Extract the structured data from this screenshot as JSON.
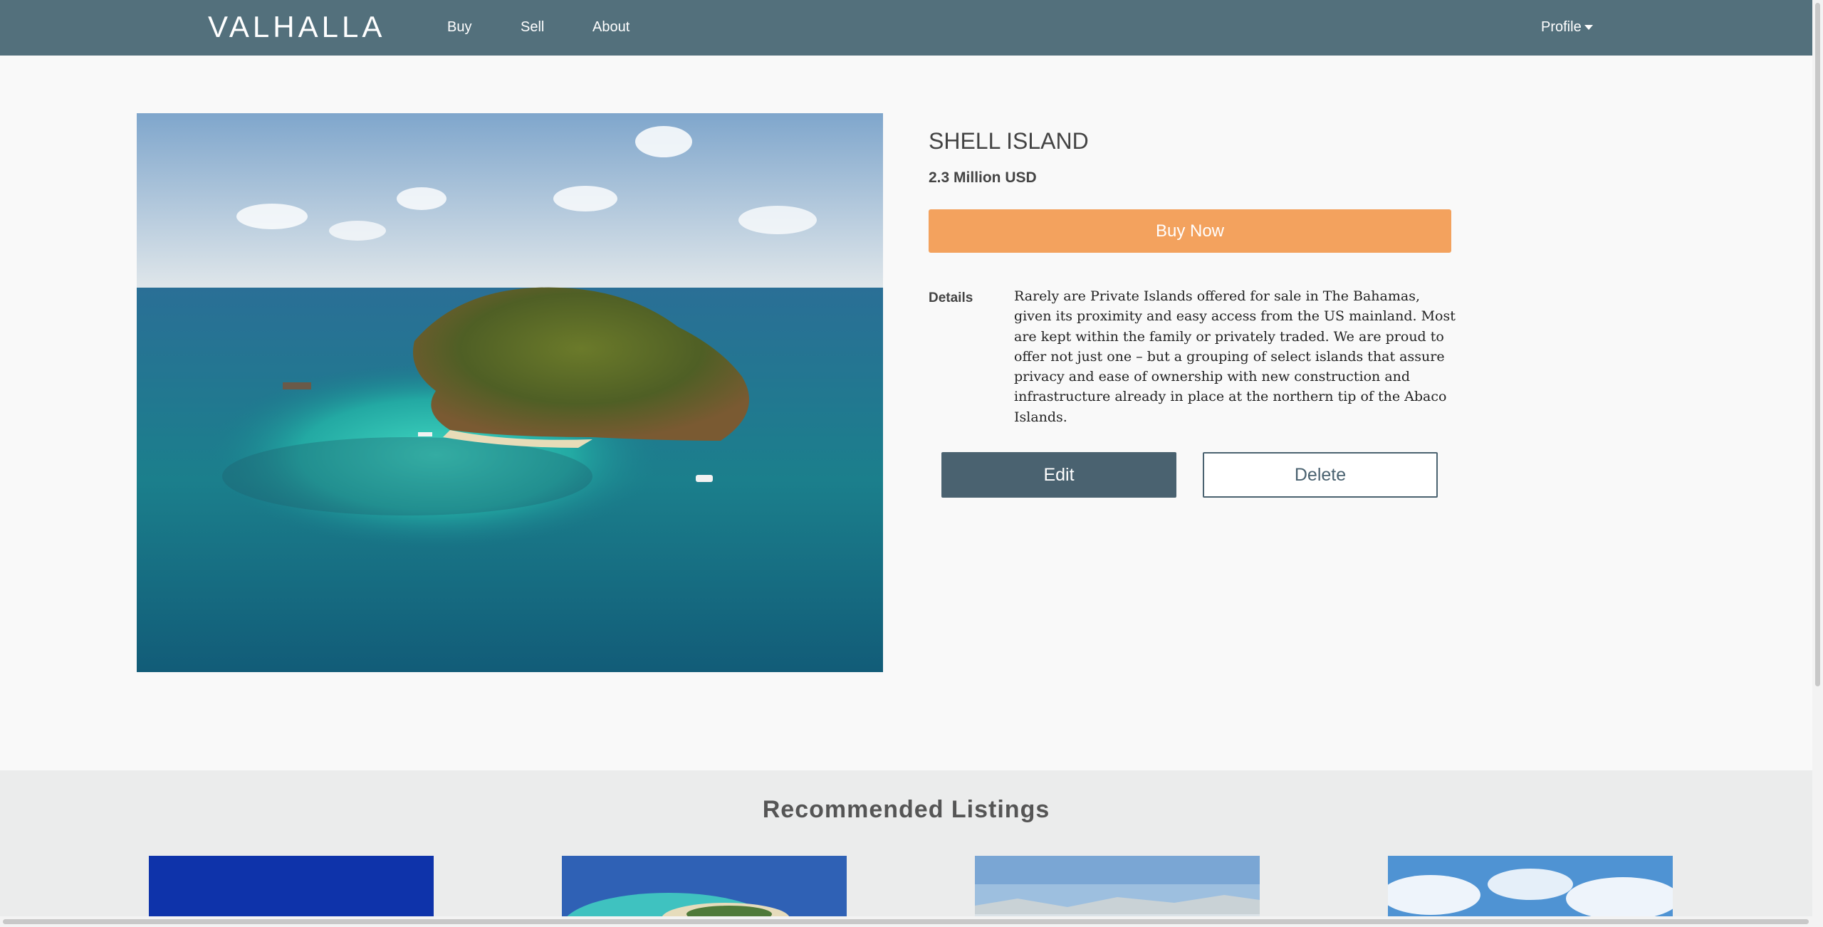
{
  "nav": {
    "brand": "VALHALLA",
    "links": [
      "Buy",
      "Sell",
      "About"
    ],
    "profile_label": "Profile"
  },
  "listing": {
    "title": "SHELL ISLAND",
    "price": "2.3 Million USD",
    "buy_label": "Buy Now",
    "details_label": "Details",
    "details_text": "Rarely are Private Islands offered for sale in The Bahamas, given its proximity and easy access from the US mainland. Most are kept within the family or privately traded. We are proud to offer not just one – but a grouping of select islands that assure privacy and ease of ownership with new construction and infrastructure already in place at the northern tip of the Abaco Islands.",
    "edit_label": "Edit",
    "delete_label": "Delete"
  },
  "recommended": {
    "title": "Recommended Listings"
  },
  "colors": {
    "navbar": "#53707c",
    "buy_button": "#f3a25e",
    "edit_button": "#4a6270"
  }
}
